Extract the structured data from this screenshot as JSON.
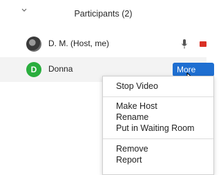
{
  "participants": {
    "title": "Participants (2)",
    "chevron_icon": "chevron-down-icon",
    "rows": [
      {
        "name": "D. M. (Host, me)",
        "avatar_icon": "photo-avatar",
        "mic_icon": "microphone-icon",
        "video_icon": "video-off-icon"
      },
      {
        "name": "Donna",
        "avatar_letter": "D",
        "avatar_color": "#2aae3e"
      }
    ],
    "more_label": "More"
  },
  "context_menu": {
    "items": [
      {
        "label": "Stop Video"
      },
      {
        "label": "Make Host"
      },
      {
        "label": "Rename"
      },
      {
        "label": "Put in Waiting Room"
      },
      {
        "label": "Remove"
      },
      {
        "label": "Report"
      }
    ]
  },
  "colors": {
    "accent": "#1f6fd1",
    "selected_row": "#f3f3f3",
    "video_off": "#d93025"
  }
}
